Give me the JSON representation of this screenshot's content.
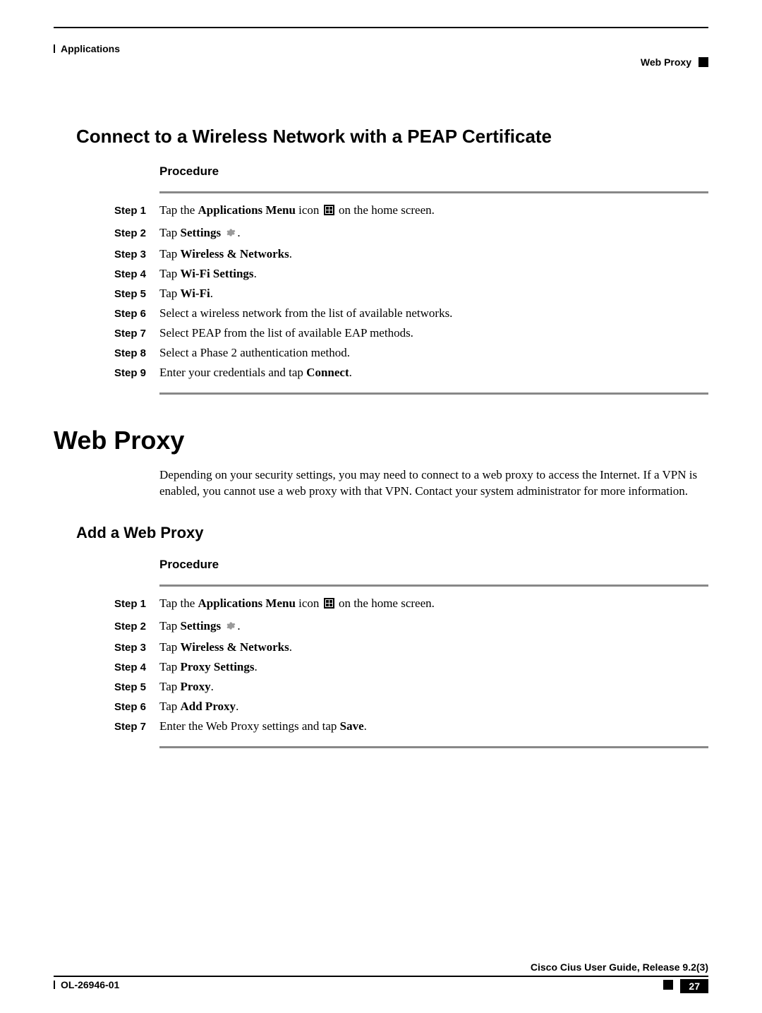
{
  "header": {
    "left": "Applications",
    "right": "Web Proxy"
  },
  "section1": {
    "title": "Connect to a Wireless Network with a PEAP Certificate",
    "procedure_label": "Procedure",
    "steps": [
      {
        "n": "Step 1",
        "pre": "Tap the ",
        "b1": "Applications Menu",
        "mid": " icon ",
        "icon": "grid",
        "post": " on the home screen."
      },
      {
        "n": "Step 2",
        "pre": "Tap ",
        "b1": "Settings",
        "mid": " ",
        "icon": "gear",
        "post": "."
      },
      {
        "n": "Step 3",
        "pre": "Tap ",
        "b1": "Wireless & Networks",
        "post": "."
      },
      {
        "n": "Step 4",
        "pre": "Tap ",
        "b1": "Wi-Fi Settings",
        "post": "."
      },
      {
        "n": "Step 5",
        "pre": "Tap ",
        "b1": "Wi-Fi",
        "post": "."
      },
      {
        "n": "Step 6",
        "plain": "Select a wireless network from the list of available networks."
      },
      {
        "n": "Step 7",
        "plain": "Select PEAP from the list of available EAP methods."
      },
      {
        "n": "Step 8",
        "plain": "Select a Phase 2 authentication method."
      },
      {
        "n": "Step 9",
        "pre": "Enter your credentials and tap ",
        "b1": "Connect",
        "post": "."
      }
    ]
  },
  "section2": {
    "title": "Web Proxy",
    "body": "Depending on your security settings, you may need to connect to a web proxy to access the Internet. If a VPN is enabled, you cannot use a web proxy with that VPN. Contact your system administrator for more information."
  },
  "section3": {
    "title": "Add a Web Proxy",
    "procedure_label": "Procedure",
    "steps": [
      {
        "n": "Step 1",
        "pre": "Tap the ",
        "b1": "Applications Menu",
        "mid": " icon ",
        "icon": "grid",
        "post": " on the home screen."
      },
      {
        "n": "Step 2",
        "pre": "Tap ",
        "b1": "Settings",
        "mid": " ",
        "icon": "gear",
        "post": "."
      },
      {
        "n": "Step 3",
        "pre": "Tap ",
        "b1": "Wireless & Networks",
        "post": "."
      },
      {
        "n": "Step 4",
        "pre": "Tap ",
        "b1": "Proxy Settings",
        "post": "."
      },
      {
        "n": "Step 5",
        "pre": "Tap ",
        "b1": "Proxy",
        "post": "."
      },
      {
        "n": "Step 6",
        "pre": "Tap ",
        "b1": "Add Proxy",
        "post": "."
      },
      {
        "n": "Step 7",
        "pre": "Enter the Web Proxy settings and tap ",
        "b1": "Save",
        "post": "."
      }
    ]
  },
  "footer": {
    "guide": "Cisco Cius User Guide, Release 9.2(3)",
    "doc": "OL-26946-01",
    "page": "27"
  }
}
